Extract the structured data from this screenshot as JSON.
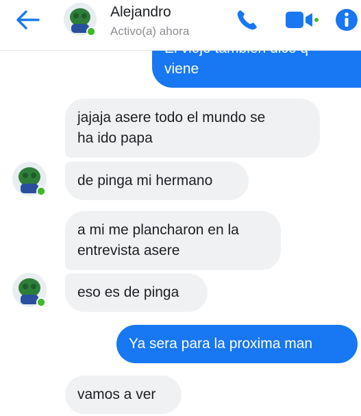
{
  "header": {
    "contact_name": "Alejandro",
    "status": "Activo(a) ahora"
  },
  "messages": {
    "m0": {
      "lines": [
        "El viejo también dice q",
        "viene"
      ]
    },
    "m1": {
      "lines": [
        "jajaja asere todo el mundo se",
        "ha ido papa"
      ]
    },
    "m2": {
      "lines": [
        "de pinga mi hermano"
      ]
    },
    "m3": {
      "lines": [
        "a mi me plancharon en la",
        "entrevista asere"
      ]
    },
    "m4": {
      "lines": [
        "eso es de pinga"
      ]
    },
    "m5": {
      "lines": [
        "Ya sera para la proxima man"
      ]
    },
    "m6": {
      "lines": [
        "vamos a ver"
      ]
    }
  },
  "colors": {
    "accent": "#1877f2",
    "incoming_bubble": "#f0f1f3",
    "online_dot": "#42b72a"
  },
  "icons": [
    "back-arrow-icon",
    "phone-icon",
    "video-camera-icon",
    "info-icon"
  ]
}
